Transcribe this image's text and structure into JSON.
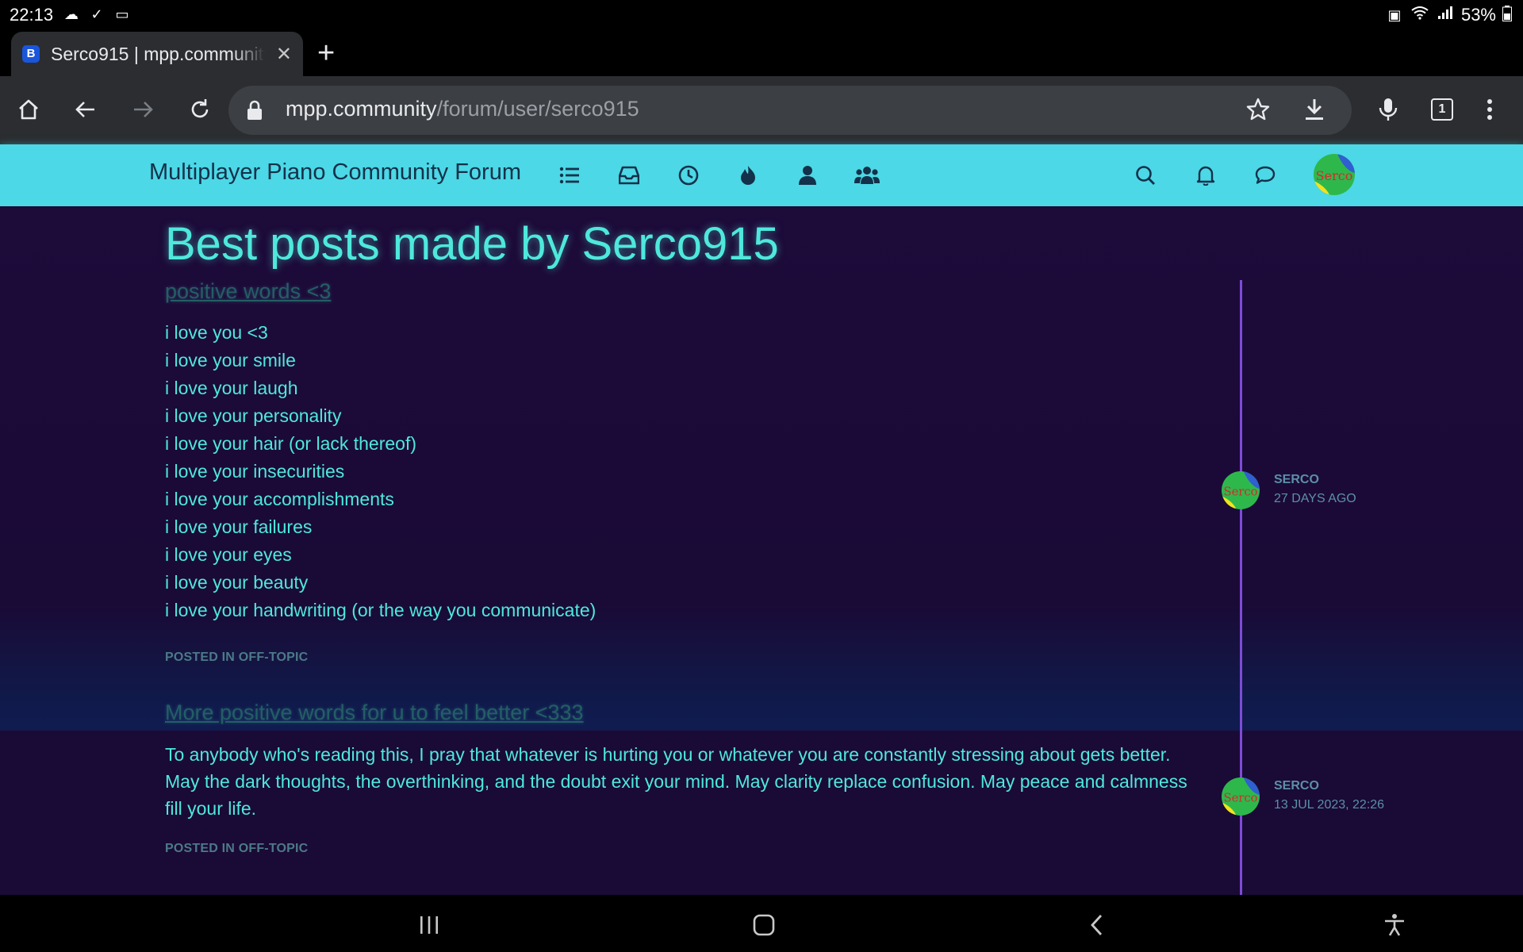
{
  "status_bar": {
    "time": "22:13",
    "battery": "53%"
  },
  "tab": {
    "title": "Serco915 | mpp.community",
    "favicon_letter": "B"
  },
  "address_bar": {
    "url_host": "mpp.community",
    "url_path": "/forum/user/serco915",
    "tab_count": "1"
  },
  "forum": {
    "title": "Multiplayer Piano Community Forum",
    "avatar_text": "Serco",
    "nav_icons": [
      "categories-icon",
      "unread-icon",
      "recent-icon",
      "popular-icon",
      "users-icon",
      "groups-icon"
    ],
    "right_icons": [
      "search-icon",
      "notifications-icon",
      "chats-icon"
    ]
  },
  "page": {
    "heading": "Best posts made by Serco915"
  },
  "posts": [
    {
      "title": "positive words <3",
      "lines": [
        "i love you <3",
        "i love your smile",
        "i love your laugh",
        "i love your personality",
        "i love your hair (or lack thereof)",
        "i love your insecurities",
        "i love your accomplishments",
        "i love your failures",
        "i love your eyes",
        "i love your beauty",
        "i love your handwriting (or the way you communicate)"
      ],
      "posted_in_label": "POSTED IN",
      "category": "OFF-TOPIC",
      "author": "SERCO",
      "time": "27 DAYS AGO"
    },
    {
      "title": "More positive words for u to feel better <333",
      "body": "To anybody who's reading this, I pray that whatever is hurting you or whatever you are constantly stressing about gets better. May the dark thoughts, the overthinking, and the doubt exit your mind. May clarity replace confusion. May peace and calmness fill your life.",
      "posted_in_label": "POSTED IN",
      "category": "OFF-TOPIC",
      "author": "SERCO",
      "time": "13 JUL 2023, 22:26"
    }
  ],
  "colors": {
    "accent": "#4ee8dc",
    "header_bg": "#4cd8e6",
    "page_bg": "#1a0a36",
    "timeline": "#7d4bd8"
  }
}
